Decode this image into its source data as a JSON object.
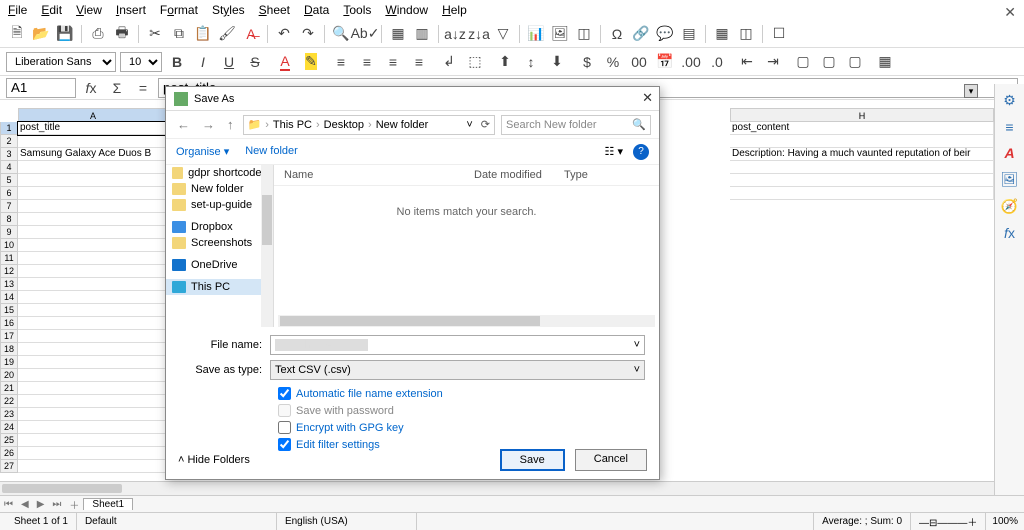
{
  "menu": {
    "file": "File",
    "edit": "Edit",
    "view": "View",
    "insert": "Insert",
    "format": "Format",
    "styles": "Styles",
    "sheet": "Sheet",
    "data": "Data",
    "tools": "Tools",
    "window": "Window",
    "help": "Help"
  },
  "font": {
    "name": "Liberation Sans",
    "size": "10"
  },
  "cellref": "A1",
  "formula_clipped": "post_title",
  "columns": {
    "A": "A",
    "H": "post_content"
  },
  "cells": {
    "A1": "post_title",
    "A3": "Samsung Galaxy Ace Duos B",
    "H1": "post_content",
    "H3": "Description: Having a much vaunted reputation of beir"
  },
  "rows": [
    "1",
    "2",
    "3",
    "4",
    "5",
    "6",
    "7",
    "8",
    "9",
    "10",
    "11",
    "12",
    "13",
    "14",
    "15",
    "16",
    "17",
    "18",
    "19",
    "20",
    "21",
    "22",
    "23",
    "24",
    "25",
    "26",
    "27"
  ],
  "dialog": {
    "title": "Save As",
    "breadcrumb": [
      "This PC",
      "Desktop",
      "New folder"
    ],
    "search_placeholder": "Search New folder",
    "organise": "Organise",
    "newfolder": "New folder",
    "columns": {
      "name": "Name",
      "date": "Date modified",
      "type": "Type"
    },
    "noitems": "No items match your search.",
    "tree": [
      {
        "icon": "fic",
        "label": "gdpr shortcodes"
      },
      {
        "icon": "fic",
        "label": "New folder"
      },
      {
        "icon": "fic",
        "label": "set-up-guide"
      },
      {
        "icon": "dbic",
        "label": "Dropbox"
      },
      {
        "icon": "fic",
        "label": "Screenshots"
      },
      {
        "icon": "odic",
        "label": "OneDrive"
      },
      {
        "icon": "pcic",
        "label": "This PC",
        "selected": true
      }
    ],
    "filename_label": "File name:",
    "filename_value": "",
    "type_label": "Save as type:",
    "type_value": "Text CSV (.csv)",
    "auto_ext": "Automatic file name extension",
    "save_pw": "Save with password",
    "gpg": "Encrypt with GPG key",
    "filter": "Edit filter settings",
    "hide": "Hide Folders",
    "save": "Save",
    "cancel": "Cancel"
  },
  "status": {
    "sheet": "Sheet 1 of 1",
    "style": "Default",
    "lang": "English (USA)",
    "avg": "Average: ; Sum: 0",
    "zoom": "100%"
  },
  "tab": "Sheet1"
}
